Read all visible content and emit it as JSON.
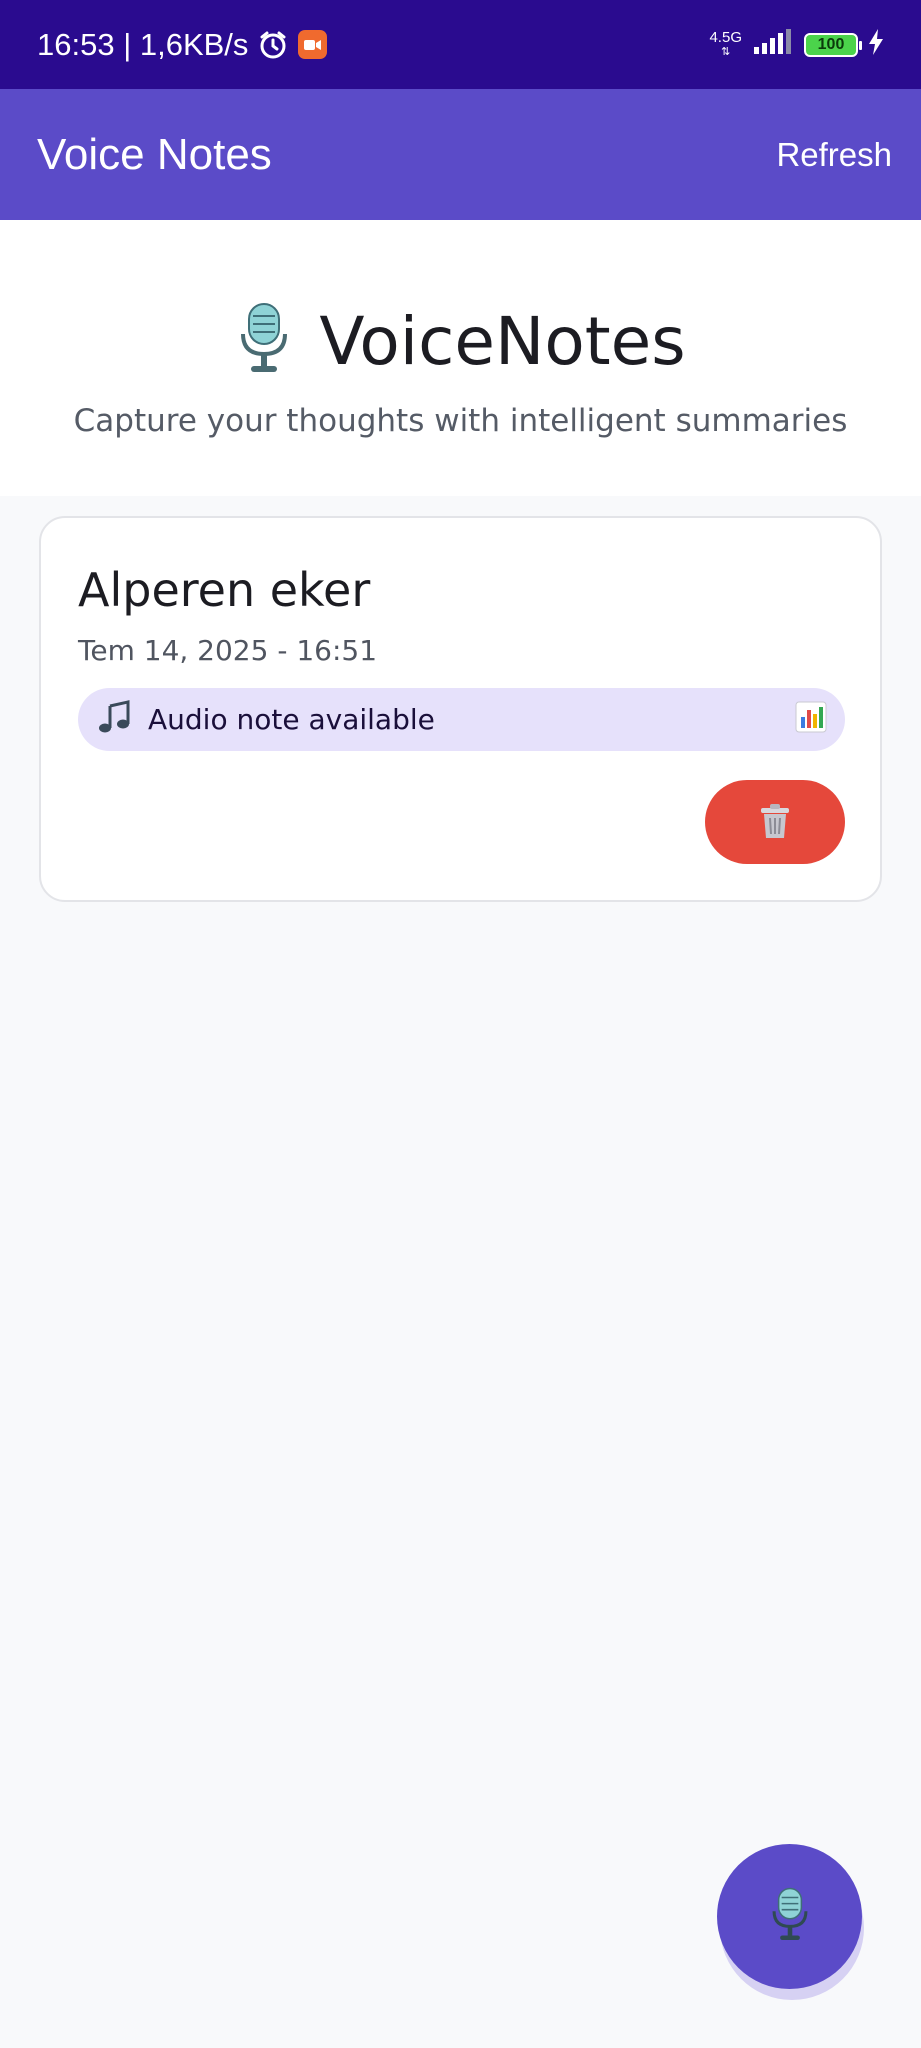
{
  "status_bar": {
    "time_speed": "16:53 | 1,6KB/s",
    "network": "4.5G",
    "battery": "100"
  },
  "app_bar": {
    "title": "Voice Notes",
    "refresh_label": "Refresh"
  },
  "hero": {
    "title": "VoiceNotes",
    "subtitle": "Capture your thoughts with intelligent summaries"
  },
  "notes": [
    {
      "title": "Alperen eker",
      "date": "Tem 14, 2025 - 16:51",
      "audio_label": "Audio note available"
    }
  ],
  "colors": {
    "status_bar": "#2a0b8f",
    "app_bar": "#5b4bc8",
    "delete": "#e5483b",
    "audio_pill": "#e6e1fb"
  },
  "icons": {
    "hero": "microphone-icon",
    "audio": "music-note-icon",
    "chart": "bar-chart-icon",
    "delete": "trash-icon",
    "fab": "microphone-icon"
  }
}
